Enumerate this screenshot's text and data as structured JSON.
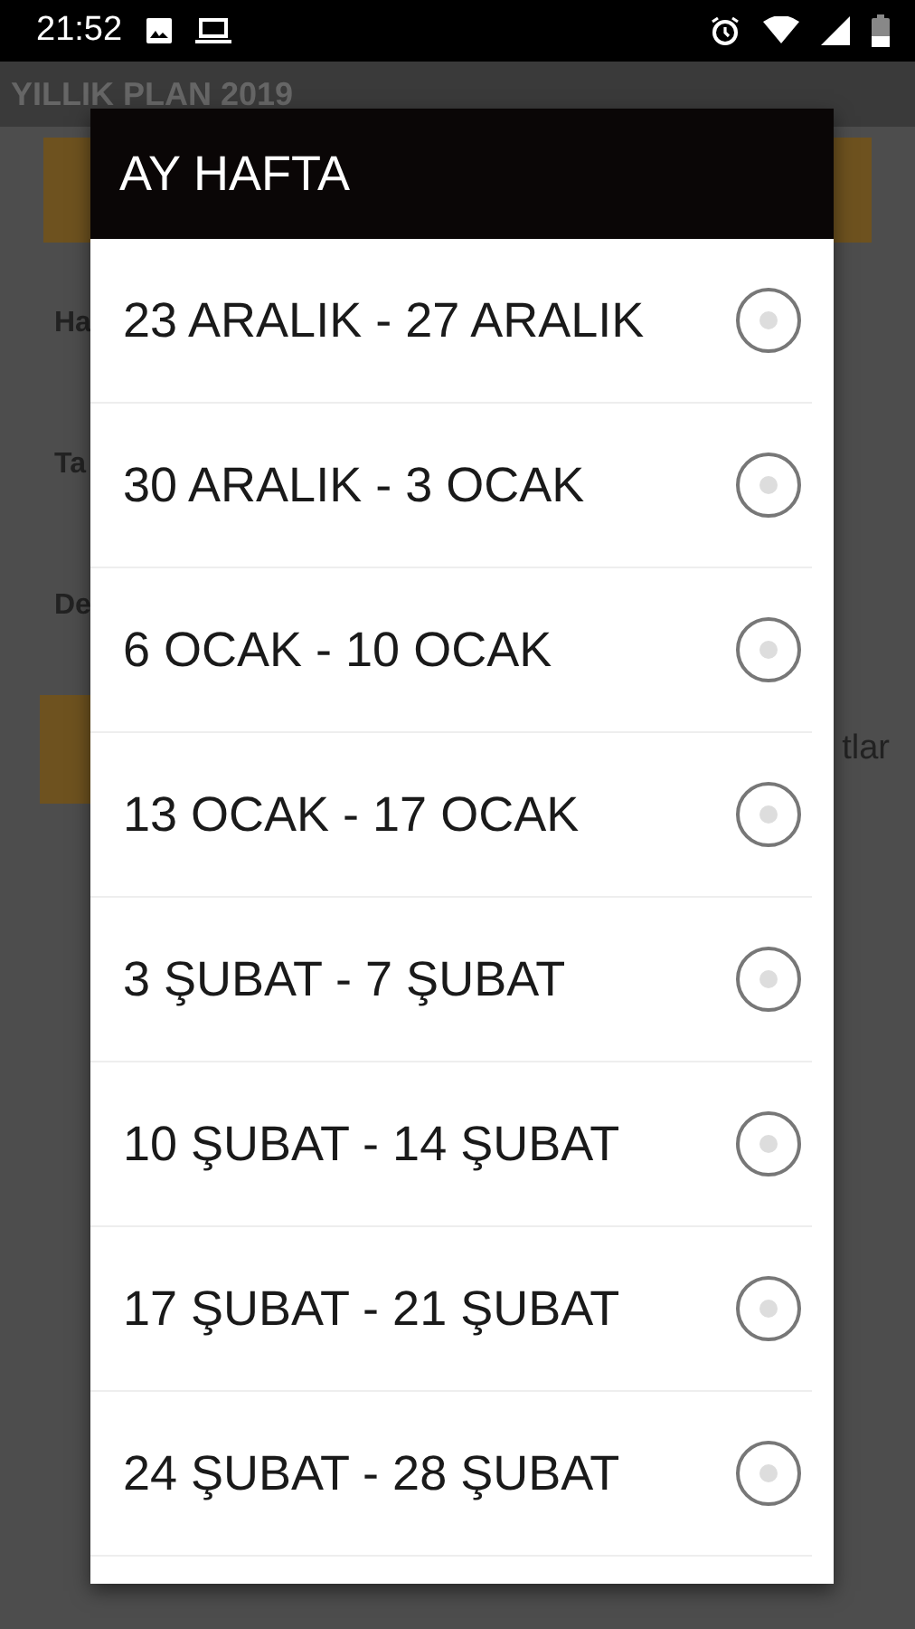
{
  "status_bar": {
    "time": "21:52"
  },
  "app_bar": {
    "title": "YILLIK PLAN 2019"
  },
  "background": {
    "field_labels": [
      "Ha",
      "Ta",
      "De"
    ],
    "button_fragment": "tlar"
  },
  "dialog": {
    "title": "AY HAFTA",
    "items": [
      {
        "label": "23 ARALIK - 27 ARALIK",
        "selected": false
      },
      {
        "label": "30 ARALIK - 3 OCAK",
        "selected": false
      },
      {
        "label": "6 OCAK - 10 OCAK",
        "selected": false
      },
      {
        "label": "13 OCAK - 17 OCAK",
        "selected": false
      },
      {
        "label": "3 ŞUBAT - 7 ŞUBAT",
        "selected": false
      },
      {
        "label": "10 ŞUBAT - 14 ŞUBAT",
        "selected": false
      },
      {
        "label": "17 ŞUBAT - 21 ŞUBAT",
        "selected": false
      },
      {
        "label": "24 ŞUBAT - 28 ŞUBAT",
        "selected": false
      }
    ]
  }
}
